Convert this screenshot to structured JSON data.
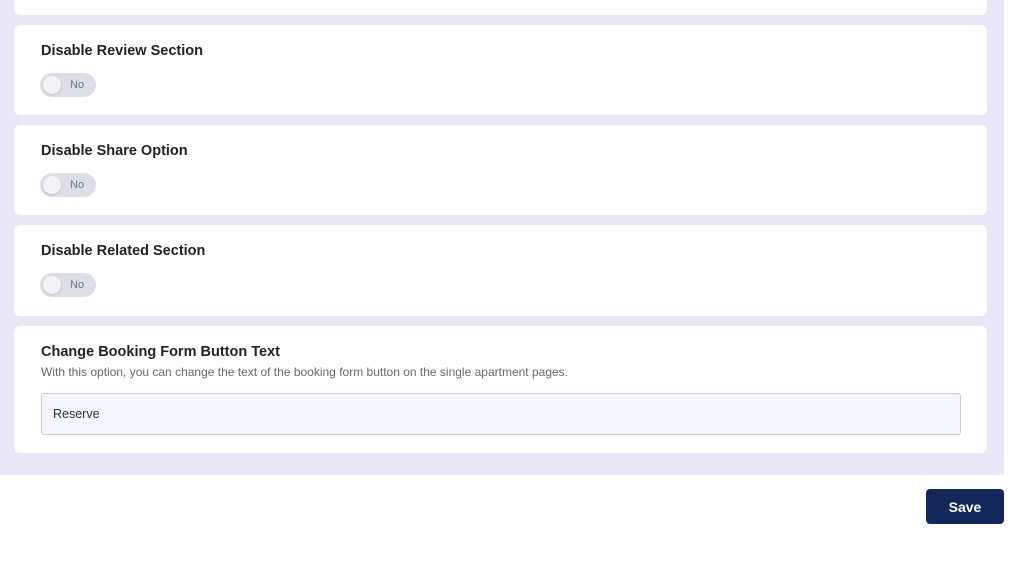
{
  "settings": {
    "disable_review": {
      "title": "Disable Review Section",
      "toggle_label": "No"
    },
    "disable_share": {
      "title": "Disable Share Option",
      "toggle_label": "No"
    },
    "disable_related": {
      "title": "Disable Related Section",
      "toggle_label": "No"
    },
    "booking_button_text": {
      "title": "Change Booking Form Button Text",
      "description": "With this option, you can change the text of the booking form button on the single apartment pages.",
      "value": "Reserve"
    }
  },
  "actions": {
    "save_label": "Save"
  },
  "colors": {
    "panel_background": "#e9e7f7",
    "save_button": "#14275c",
    "input_background": "#f3f6fd",
    "toggle_off": "#dcdfe6"
  }
}
